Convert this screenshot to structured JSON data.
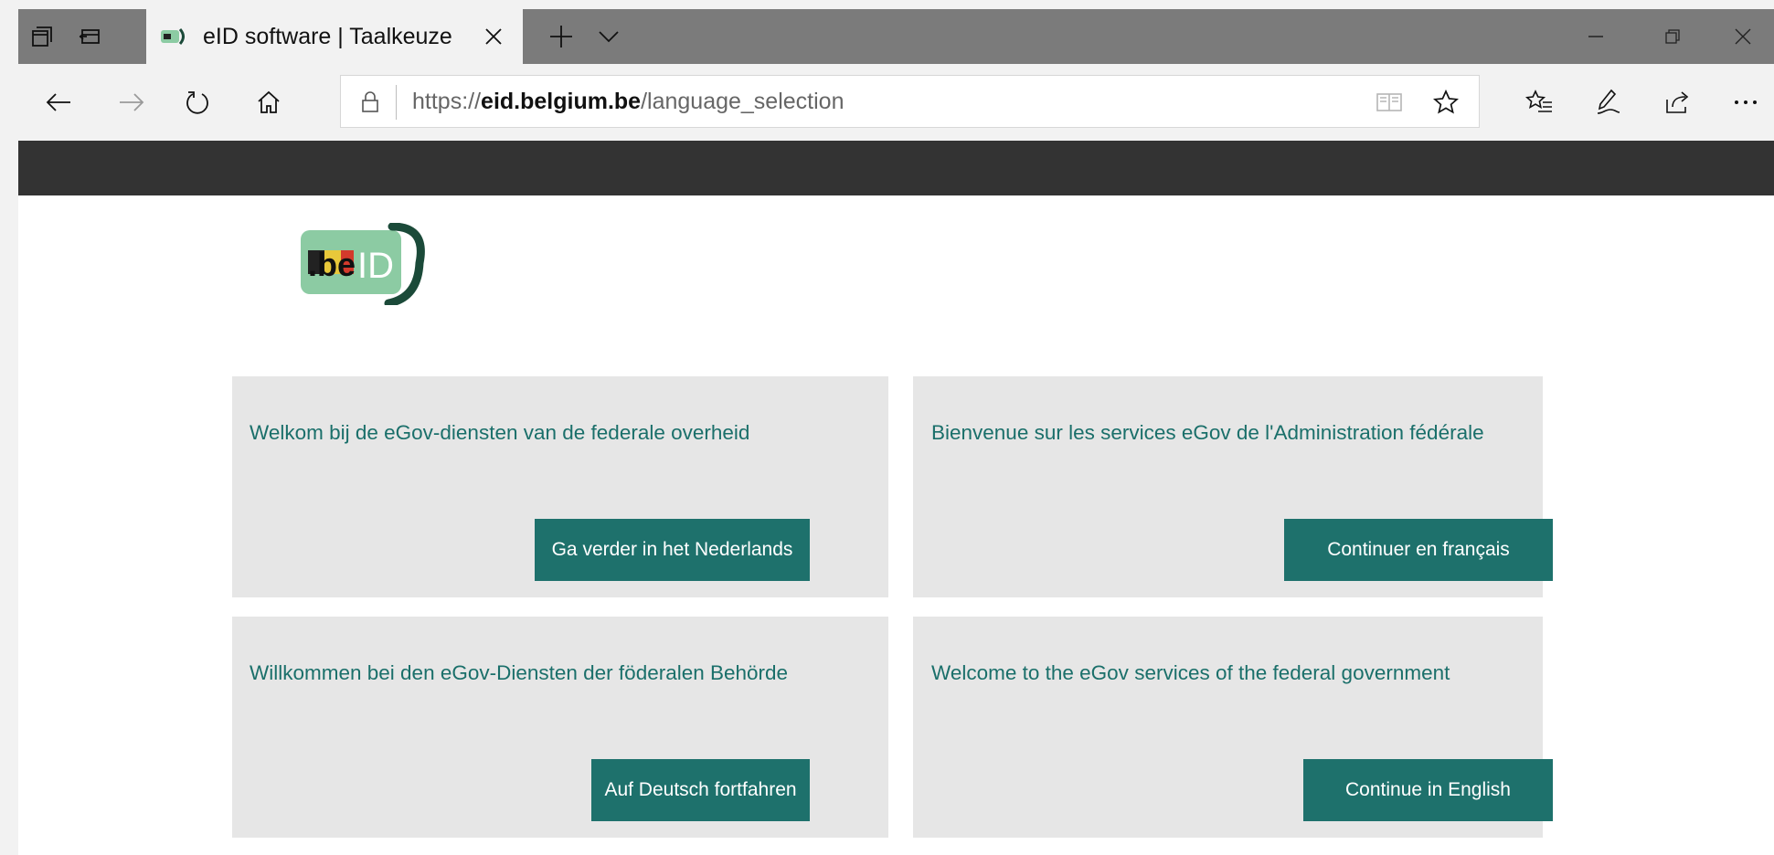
{
  "browser": {
    "tab": {
      "title": "eID software | Taalkeuze"
    },
    "address_bar": {
      "url_prefix": "https://",
      "url_domain": "eid.belgium.be",
      "url_path": "/language_selection"
    },
    "icons": {
      "tab_actions": "tab-actions-icon",
      "set_aside_tabs": "set-aside-tabs-icon",
      "favicon": "beid-favicon-icon",
      "close_tab": "close-icon",
      "new_tab": "plus-icon",
      "tab_preview": "chevron-down-icon",
      "minimize": "minimize-icon",
      "restore": "restore-icon",
      "close_window": "close-icon",
      "back": "arrow-left-icon",
      "forward": "arrow-right-icon",
      "refresh": "refresh-icon",
      "home": "home-icon",
      "lock": "lock-icon",
      "reading_view": "book-icon",
      "favorite": "star-icon",
      "favorites_hub": "favorites-list-icon",
      "notes": "pen-icon",
      "share": "share-icon",
      "more": "more-icon"
    }
  },
  "page": {
    "logo": {
      "text_be": ".be",
      "text_id": "ID"
    },
    "cards": [
      {
        "heading": "Welkom bij de eGov-diensten van de federale overheid",
        "button": "Ga verder in het Nederlands"
      },
      {
        "heading": "Bienvenue sur les services eGov de l'Administration fédérale",
        "button": "Continuer en français"
      },
      {
        "heading": "Willkommen bei den eGov-Diensten der föderalen Behörde",
        "button": "Auf Deutsch fortfahren"
      },
      {
        "heading": "Welcome to the eGov services of the federal government",
        "button": "Continue in English"
      }
    ]
  },
  "colors": {
    "card_bg": "#e6e6e6",
    "card_text": "#1a6f6a",
    "button_bg": "#1e716c",
    "header_dark": "#333333",
    "logo_green": "#8ccba3",
    "logo_dark": "#1b4a39"
  }
}
